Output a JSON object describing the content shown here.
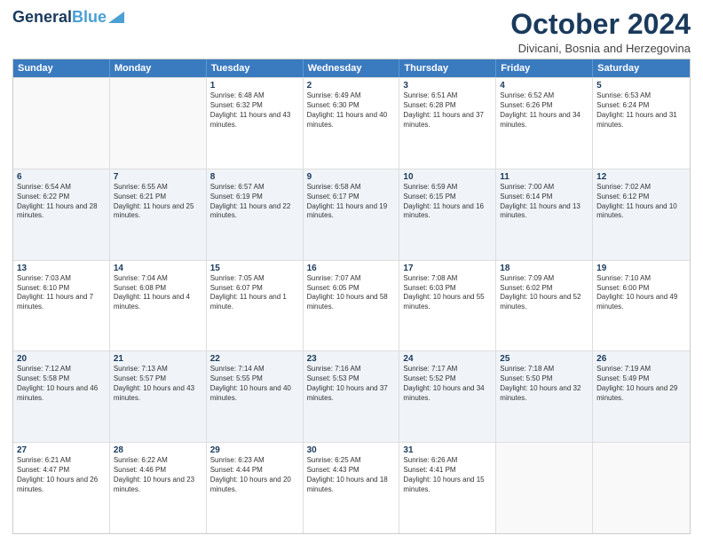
{
  "header": {
    "logo_line1": "General",
    "logo_line2": "Blue",
    "month": "October 2024",
    "location": "Divicani, Bosnia and Herzegovina"
  },
  "days_of_week": [
    "Sunday",
    "Monday",
    "Tuesday",
    "Wednesday",
    "Thursday",
    "Friday",
    "Saturday"
  ],
  "weeks": [
    [
      {
        "day": "",
        "sunrise": "",
        "sunset": "",
        "daylight": "",
        "alt": false
      },
      {
        "day": "",
        "sunrise": "",
        "sunset": "",
        "daylight": "",
        "alt": false
      },
      {
        "day": "1",
        "sunrise": "Sunrise: 6:48 AM",
        "sunset": "Sunset: 6:32 PM",
        "daylight": "Daylight: 11 hours and 43 minutes.",
        "alt": false
      },
      {
        "day": "2",
        "sunrise": "Sunrise: 6:49 AM",
        "sunset": "Sunset: 6:30 PM",
        "daylight": "Daylight: 11 hours and 40 minutes.",
        "alt": false
      },
      {
        "day": "3",
        "sunrise": "Sunrise: 6:51 AM",
        "sunset": "Sunset: 6:28 PM",
        "daylight": "Daylight: 11 hours and 37 minutes.",
        "alt": false
      },
      {
        "day": "4",
        "sunrise": "Sunrise: 6:52 AM",
        "sunset": "Sunset: 6:26 PM",
        "daylight": "Daylight: 11 hours and 34 minutes.",
        "alt": false
      },
      {
        "day": "5",
        "sunrise": "Sunrise: 6:53 AM",
        "sunset": "Sunset: 6:24 PM",
        "daylight": "Daylight: 11 hours and 31 minutes.",
        "alt": false
      }
    ],
    [
      {
        "day": "6",
        "sunrise": "Sunrise: 6:54 AM",
        "sunset": "Sunset: 6:22 PM",
        "daylight": "Daylight: 11 hours and 28 minutes.",
        "alt": true
      },
      {
        "day": "7",
        "sunrise": "Sunrise: 6:55 AM",
        "sunset": "Sunset: 6:21 PM",
        "daylight": "Daylight: 11 hours and 25 minutes.",
        "alt": true
      },
      {
        "day": "8",
        "sunrise": "Sunrise: 6:57 AM",
        "sunset": "Sunset: 6:19 PM",
        "daylight": "Daylight: 11 hours and 22 minutes.",
        "alt": true
      },
      {
        "day": "9",
        "sunrise": "Sunrise: 6:58 AM",
        "sunset": "Sunset: 6:17 PM",
        "daylight": "Daylight: 11 hours and 19 minutes.",
        "alt": true
      },
      {
        "day": "10",
        "sunrise": "Sunrise: 6:59 AM",
        "sunset": "Sunset: 6:15 PM",
        "daylight": "Daylight: 11 hours and 16 minutes.",
        "alt": true
      },
      {
        "day": "11",
        "sunrise": "Sunrise: 7:00 AM",
        "sunset": "Sunset: 6:14 PM",
        "daylight": "Daylight: 11 hours and 13 minutes.",
        "alt": true
      },
      {
        "day": "12",
        "sunrise": "Sunrise: 7:02 AM",
        "sunset": "Sunset: 6:12 PM",
        "daylight": "Daylight: 11 hours and 10 minutes.",
        "alt": true
      }
    ],
    [
      {
        "day": "13",
        "sunrise": "Sunrise: 7:03 AM",
        "sunset": "Sunset: 6:10 PM",
        "daylight": "Daylight: 11 hours and 7 minutes.",
        "alt": false
      },
      {
        "day": "14",
        "sunrise": "Sunrise: 7:04 AM",
        "sunset": "Sunset: 6:08 PM",
        "daylight": "Daylight: 11 hours and 4 minutes.",
        "alt": false
      },
      {
        "day": "15",
        "sunrise": "Sunrise: 7:05 AM",
        "sunset": "Sunset: 6:07 PM",
        "daylight": "Daylight: 11 hours and 1 minute.",
        "alt": false
      },
      {
        "day": "16",
        "sunrise": "Sunrise: 7:07 AM",
        "sunset": "Sunset: 6:05 PM",
        "daylight": "Daylight: 10 hours and 58 minutes.",
        "alt": false
      },
      {
        "day": "17",
        "sunrise": "Sunrise: 7:08 AM",
        "sunset": "Sunset: 6:03 PM",
        "daylight": "Daylight: 10 hours and 55 minutes.",
        "alt": false
      },
      {
        "day": "18",
        "sunrise": "Sunrise: 7:09 AM",
        "sunset": "Sunset: 6:02 PM",
        "daylight": "Daylight: 10 hours and 52 minutes.",
        "alt": false
      },
      {
        "day": "19",
        "sunrise": "Sunrise: 7:10 AM",
        "sunset": "Sunset: 6:00 PM",
        "daylight": "Daylight: 10 hours and 49 minutes.",
        "alt": false
      }
    ],
    [
      {
        "day": "20",
        "sunrise": "Sunrise: 7:12 AM",
        "sunset": "Sunset: 5:58 PM",
        "daylight": "Daylight: 10 hours and 46 minutes.",
        "alt": true
      },
      {
        "day": "21",
        "sunrise": "Sunrise: 7:13 AM",
        "sunset": "Sunset: 5:57 PM",
        "daylight": "Daylight: 10 hours and 43 minutes.",
        "alt": true
      },
      {
        "day": "22",
        "sunrise": "Sunrise: 7:14 AM",
        "sunset": "Sunset: 5:55 PM",
        "daylight": "Daylight: 10 hours and 40 minutes.",
        "alt": true
      },
      {
        "day": "23",
        "sunrise": "Sunrise: 7:16 AM",
        "sunset": "Sunset: 5:53 PM",
        "daylight": "Daylight: 10 hours and 37 minutes.",
        "alt": true
      },
      {
        "day": "24",
        "sunrise": "Sunrise: 7:17 AM",
        "sunset": "Sunset: 5:52 PM",
        "daylight": "Daylight: 10 hours and 34 minutes.",
        "alt": true
      },
      {
        "day": "25",
        "sunrise": "Sunrise: 7:18 AM",
        "sunset": "Sunset: 5:50 PM",
        "daylight": "Daylight: 10 hours and 32 minutes.",
        "alt": true
      },
      {
        "day": "26",
        "sunrise": "Sunrise: 7:19 AM",
        "sunset": "Sunset: 5:49 PM",
        "daylight": "Daylight: 10 hours and 29 minutes.",
        "alt": true
      }
    ],
    [
      {
        "day": "27",
        "sunrise": "Sunrise: 6:21 AM",
        "sunset": "Sunset: 4:47 PM",
        "daylight": "Daylight: 10 hours and 26 minutes.",
        "alt": false
      },
      {
        "day": "28",
        "sunrise": "Sunrise: 6:22 AM",
        "sunset": "Sunset: 4:46 PM",
        "daylight": "Daylight: 10 hours and 23 minutes.",
        "alt": false
      },
      {
        "day": "29",
        "sunrise": "Sunrise: 6:23 AM",
        "sunset": "Sunset: 4:44 PM",
        "daylight": "Daylight: 10 hours and 20 minutes.",
        "alt": false
      },
      {
        "day": "30",
        "sunrise": "Sunrise: 6:25 AM",
        "sunset": "Sunset: 4:43 PM",
        "daylight": "Daylight: 10 hours and 18 minutes.",
        "alt": false
      },
      {
        "day": "31",
        "sunrise": "Sunrise: 6:26 AM",
        "sunset": "Sunset: 4:41 PM",
        "daylight": "Daylight: 10 hours and 15 minutes.",
        "alt": false
      },
      {
        "day": "",
        "sunrise": "",
        "sunset": "",
        "daylight": "",
        "alt": false
      },
      {
        "day": "",
        "sunrise": "",
        "sunset": "",
        "daylight": "",
        "alt": false
      }
    ]
  ]
}
